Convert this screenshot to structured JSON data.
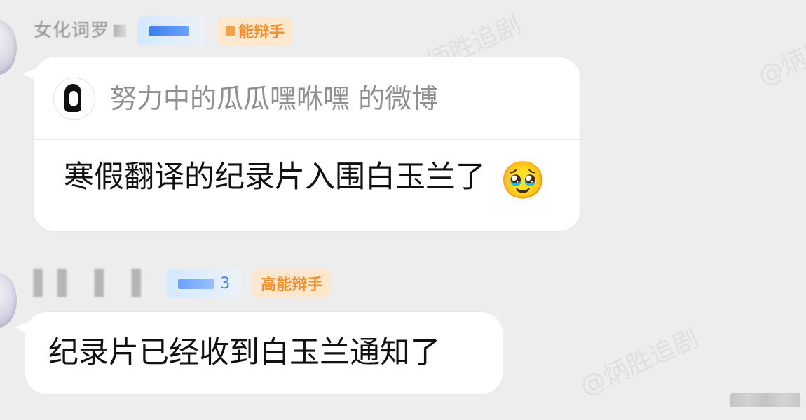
{
  "watermarks": [
    "@炳胜追剧",
    "@炳胜追剧",
    "@炳胜追剧"
  ],
  "messages": [
    {
      "user": {
        "name": "女化词罗",
        "level": "",
        "badge": "能辩手"
      },
      "quote": {
        "title": "努力中的瓜瓜嘿咻嘿 的微博"
      },
      "text": "寒假翻译的纪录片入围白玉兰了",
      "emoji": "🥹"
    },
    {
      "user": {
        "name": "▌▌ ▌ ▌",
        "level": "3",
        "badge": "高能辩手"
      },
      "text": "纪录片已经收到白玉兰通知了"
    }
  ],
  "colors": {
    "background": "#ededed",
    "bubble": "#ffffff",
    "name": "#8d8d8d",
    "level_text": "#4a7ff0",
    "badge_bg": "#fde7cd",
    "badge_text": "#ef8f2f"
  },
  "icons": [
    "avatar",
    "mini-avatar",
    "emoji",
    "more-bar"
  ]
}
